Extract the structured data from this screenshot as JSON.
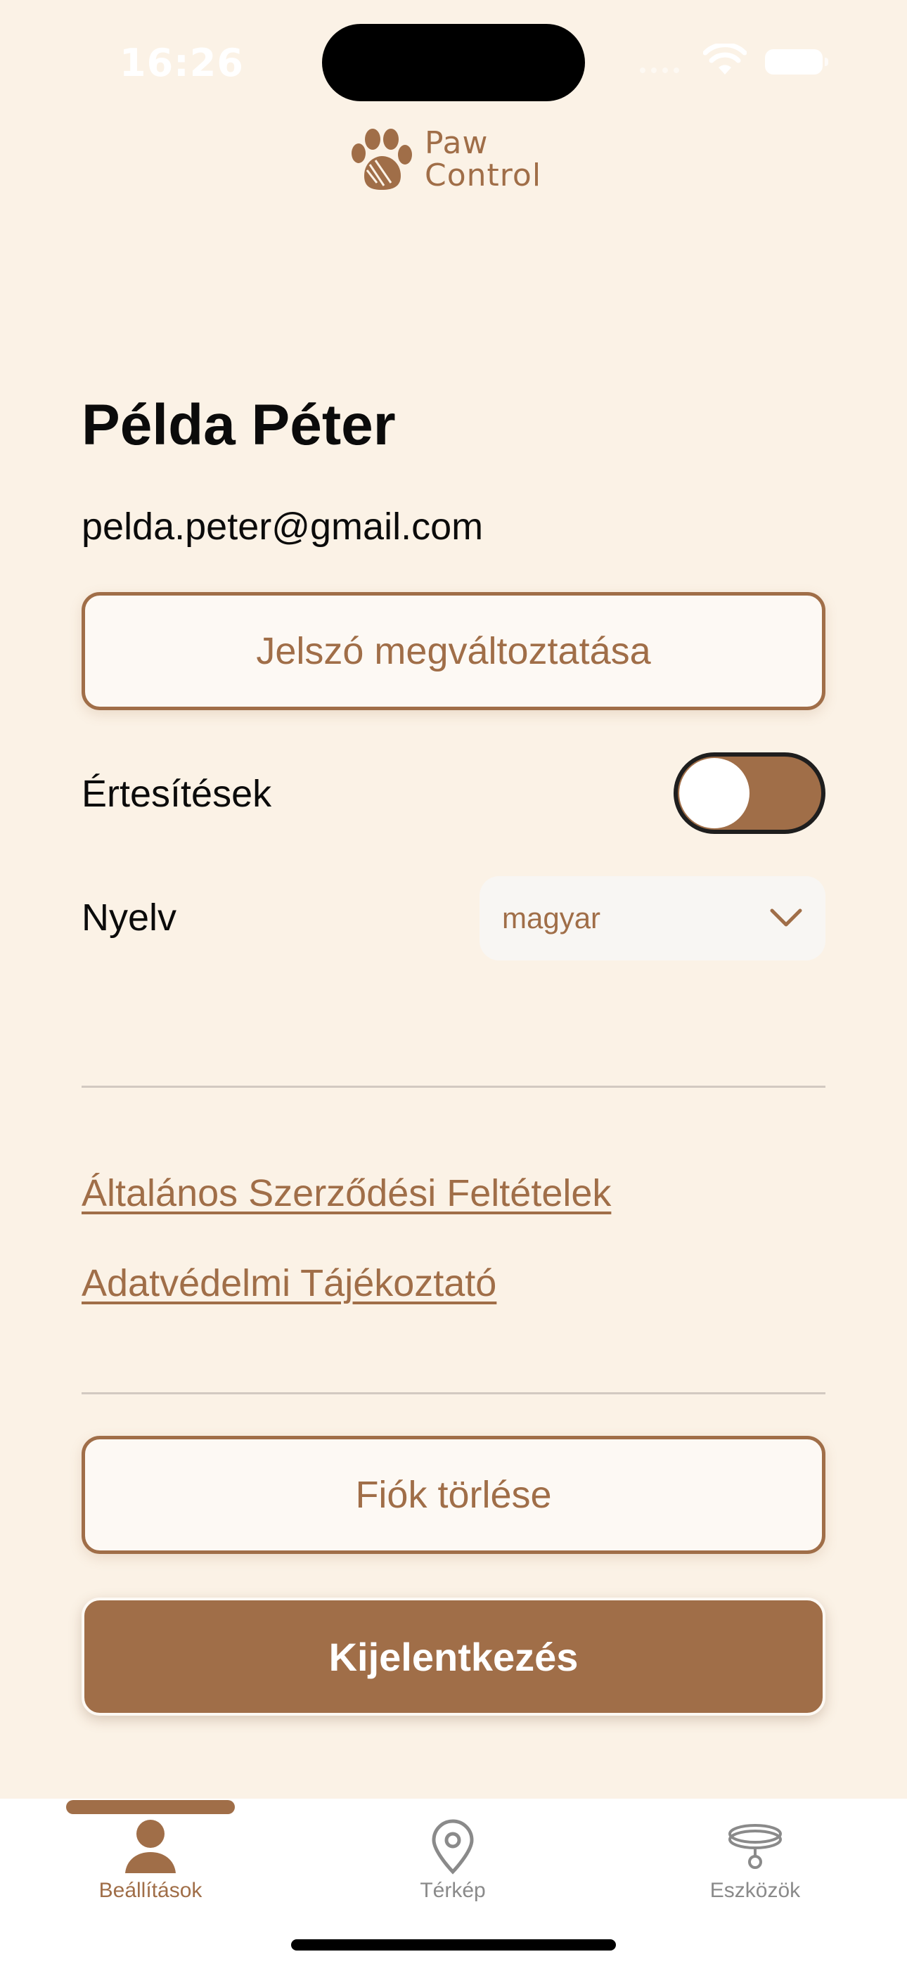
{
  "status_bar": {
    "time": "16:26"
  },
  "logo": {
    "line1": "Paw",
    "line2": "Control",
    "color": "#A06E48"
  },
  "profile": {
    "name": "Példa Péter",
    "email": "pelda.peter@gmail.com"
  },
  "actions": {
    "change_password_label": "Jelszó megváltoztatása",
    "delete_account_label": "Fiók törlése",
    "logout_label": "Kijelentkezés"
  },
  "settings": {
    "notifications_label": "Értesítések",
    "notifications_on": true,
    "language_label": "Nyelv",
    "language_value": "magyar"
  },
  "links": {
    "terms": "Általános Szerződési Feltételek",
    "privacy": "Adatvédelmi Tájékoztató"
  },
  "tab_bar": {
    "active": "settings",
    "tabs": [
      {
        "id": "settings",
        "label": "Beállítások",
        "icon": "person-icon"
      },
      {
        "id": "map",
        "label": "Térkép",
        "icon": "map-pin-icon"
      },
      {
        "id": "devices",
        "label": "Eszközök",
        "icon": "collar-icon"
      }
    ]
  },
  "colors": {
    "accent": "#A06E48",
    "background": "#FBF2E6",
    "inactive_tab": "#8A8A8A"
  }
}
